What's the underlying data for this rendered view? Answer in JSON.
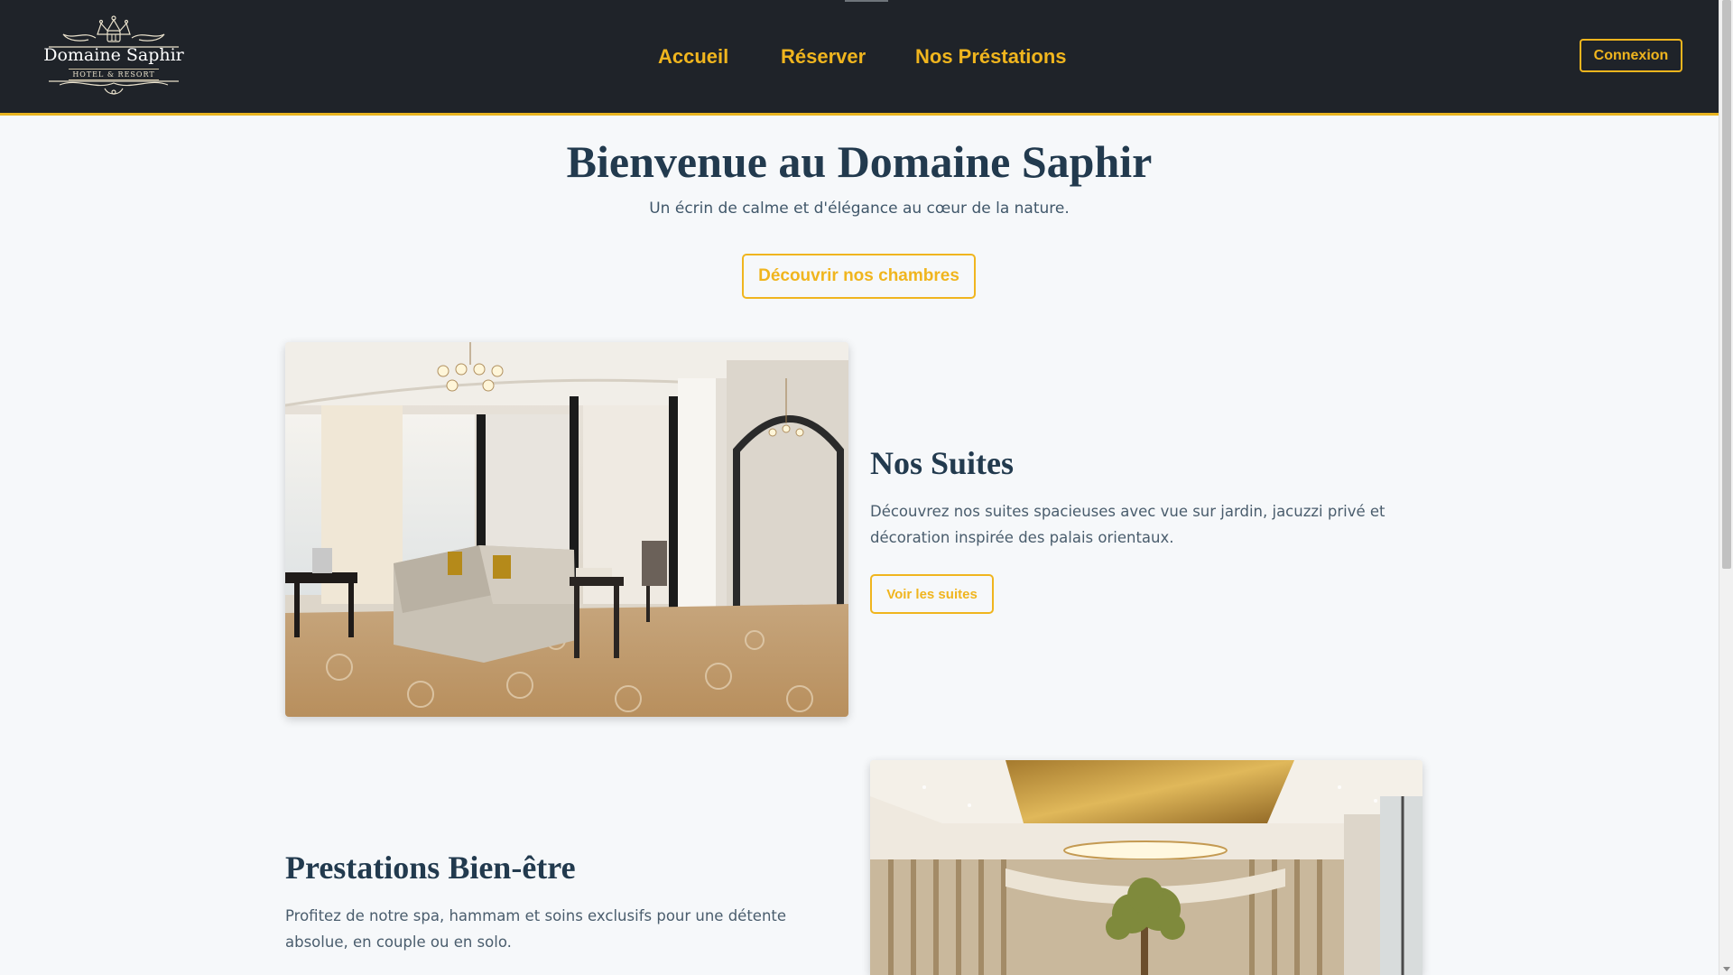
{
  "header": {
    "logo": {
      "title": "Domaine Saphir",
      "subtitle": "HOTEL & RESORT"
    },
    "nav": [
      {
        "label": "Accueil"
      },
      {
        "label": "Réserver"
      },
      {
        "label": "Nos Préstations"
      }
    ],
    "login_label": "Connexion"
  },
  "hero": {
    "title": "Bienvenue au Domaine Saphir",
    "subtitle": "Un écrin de calme et d'élégance au cœur de la nature.",
    "cta_label": "Découvrir nos chambres"
  },
  "sections": [
    {
      "title": "Nos Suites",
      "text": "Découvrez nos suites spacieuses avec vue sur jardin, jacuzzi privé et décoration inspirée des palais orientaux.",
      "button_label": "Voir les suites"
    },
    {
      "title": "Prestations Bien-être",
      "text": "Profitez de notre spa, hammam et soins exclusifs pour une détente absolue, en couple ou en solo."
    }
  ],
  "colors": {
    "header_bg": "#1f2329",
    "accent": "#f0b51e",
    "heading": "#223a4e",
    "page_bg": "#f6f8fa"
  },
  "icons": [
    "hotel-crest-logo"
  ]
}
